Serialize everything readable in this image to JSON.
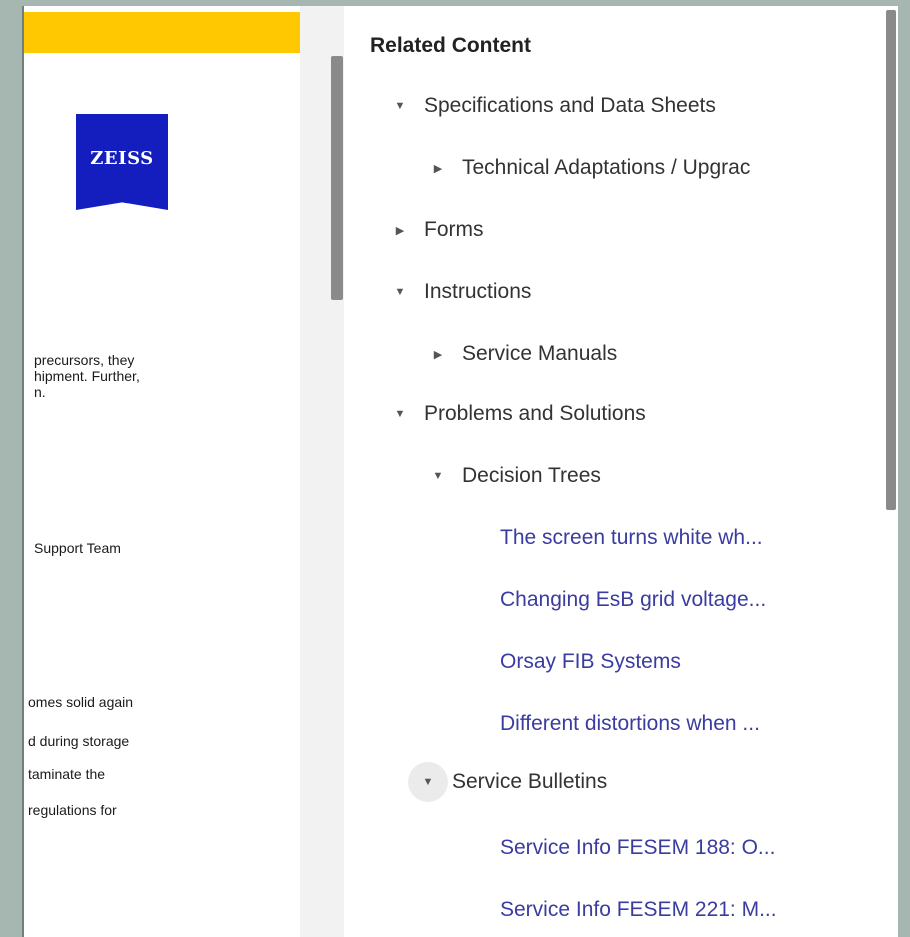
{
  "document": {
    "logo_text": "ZEISS",
    "lines": [
      {
        "text": "precursors, they"
      },
      {
        "text": "hipment. Further,"
      },
      {
        "text": "n."
      },
      {
        "text": "Support Team"
      },
      {
        "text": "omes solid again"
      },
      {
        "text": "d during storage"
      },
      {
        "text": "taminate the"
      },
      {
        "text": "regulations for"
      }
    ]
  },
  "related": {
    "title": "Related Content",
    "tree": [
      {
        "label": "Specifications and Data Sheets",
        "state": "expanded"
      },
      {
        "label": "Technical Adaptations / Upgrac",
        "state": "collapsed"
      },
      {
        "label": "Forms",
        "state": "collapsed"
      },
      {
        "label": "Instructions",
        "state": "expanded"
      },
      {
        "label": "Service Manuals",
        "state": "collapsed"
      },
      {
        "label": "Problems and Solutions",
        "state": "expanded"
      },
      {
        "label": "Decision Trees",
        "state": "expanded"
      },
      {
        "label": "Service Bulletins",
        "state": "expanded"
      }
    ],
    "links": [
      "The screen turns white wh...",
      "Changing EsB grid voltage...",
      "Orsay FIB Systems",
      "Different distortions when ...",
      "Service Info FESEM 188: O...",
      "Service Info FESEM 221: M..."
    ]
  },
  "colors": {
    "accent_yellow": "#ffc800",
    "zeiss_blue": "#141ebe",
    "link_blue": "#3a3ca0",
    "backdrop": "#a6b7b2"
  },
  "icons": {
    "expanded": "caret-down-icon",
    "collapsed": "caret-right-icon"
  }
}
